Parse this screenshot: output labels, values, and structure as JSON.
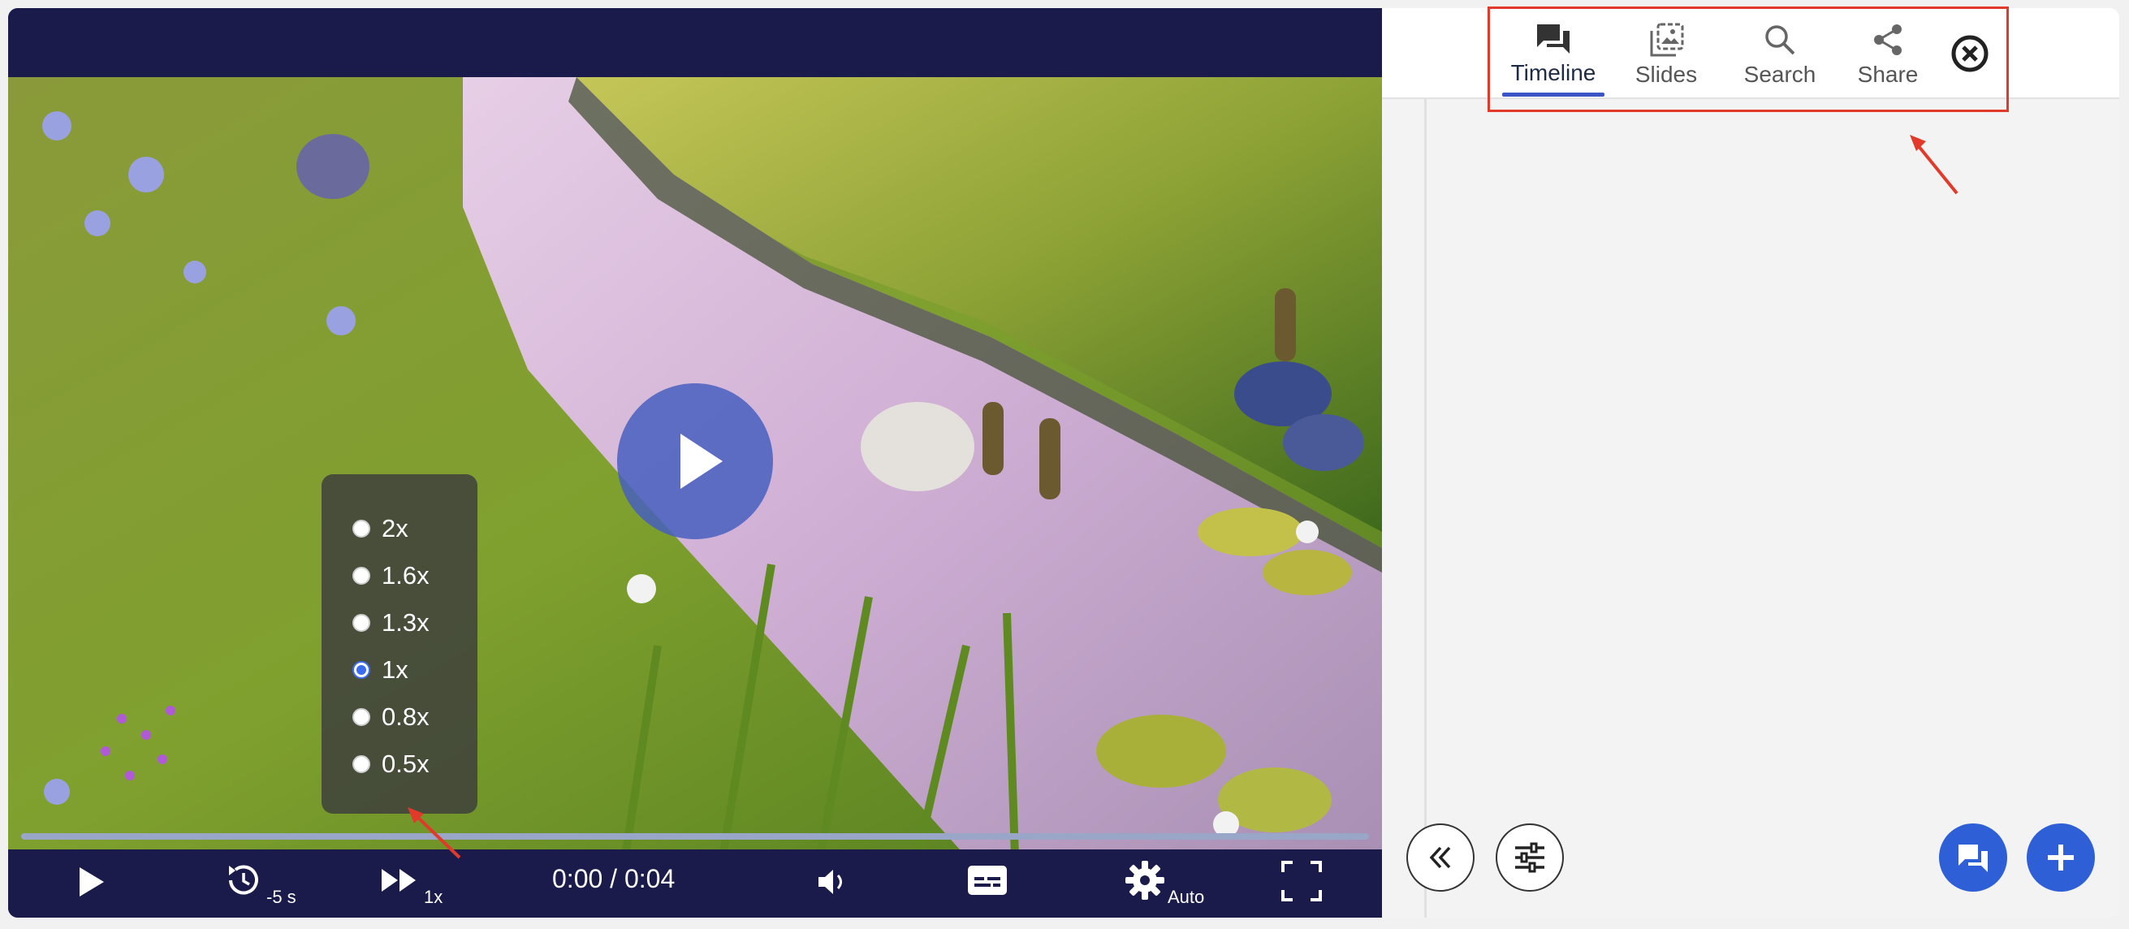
{
  "player": {
    "speed_menu": {
      "options": [
        "2x",
        "1.6x",
        "1.3x",
        "1x",
        "0.8x",
        "0.5x"
      ],
      "selected": "1x"
    },
    "controls": {
      "rewind_label": "-5 s",
      "speed_label": "1x",
      "time": "0:00 / 0:04",
      "quality_label": "Auto"
    }
  },
  "panel": {
    "tabs": [
      {
        "label": "Timeline",
        "icon": "chat-bubbles-icon",
        "active": true
      },
      {
        "label": "Slides",
        "icon": "image-gallery-icon",
        "active": false
      },
      {
        "label": "Search",
        "icon": "search-icon",
        "active": false
      },
      {
        "label": "Share",
        "icon": "share-icon",
        "active": false
      }
    ],
    "close_icon": "close-circle-icon",
    "bottom_buttons": [
      "collapse-panel-icon",
      "filter-sliders-icon",
      "comments-icon",
      "add-icon"
    ]
  },
  "colors": {
    "player_bar": "#1a1b4b",
    "accent": "#3a56c6",
    "fab": "#2f5fd6",
    "annotation": "#e23a2a"
  }
}
